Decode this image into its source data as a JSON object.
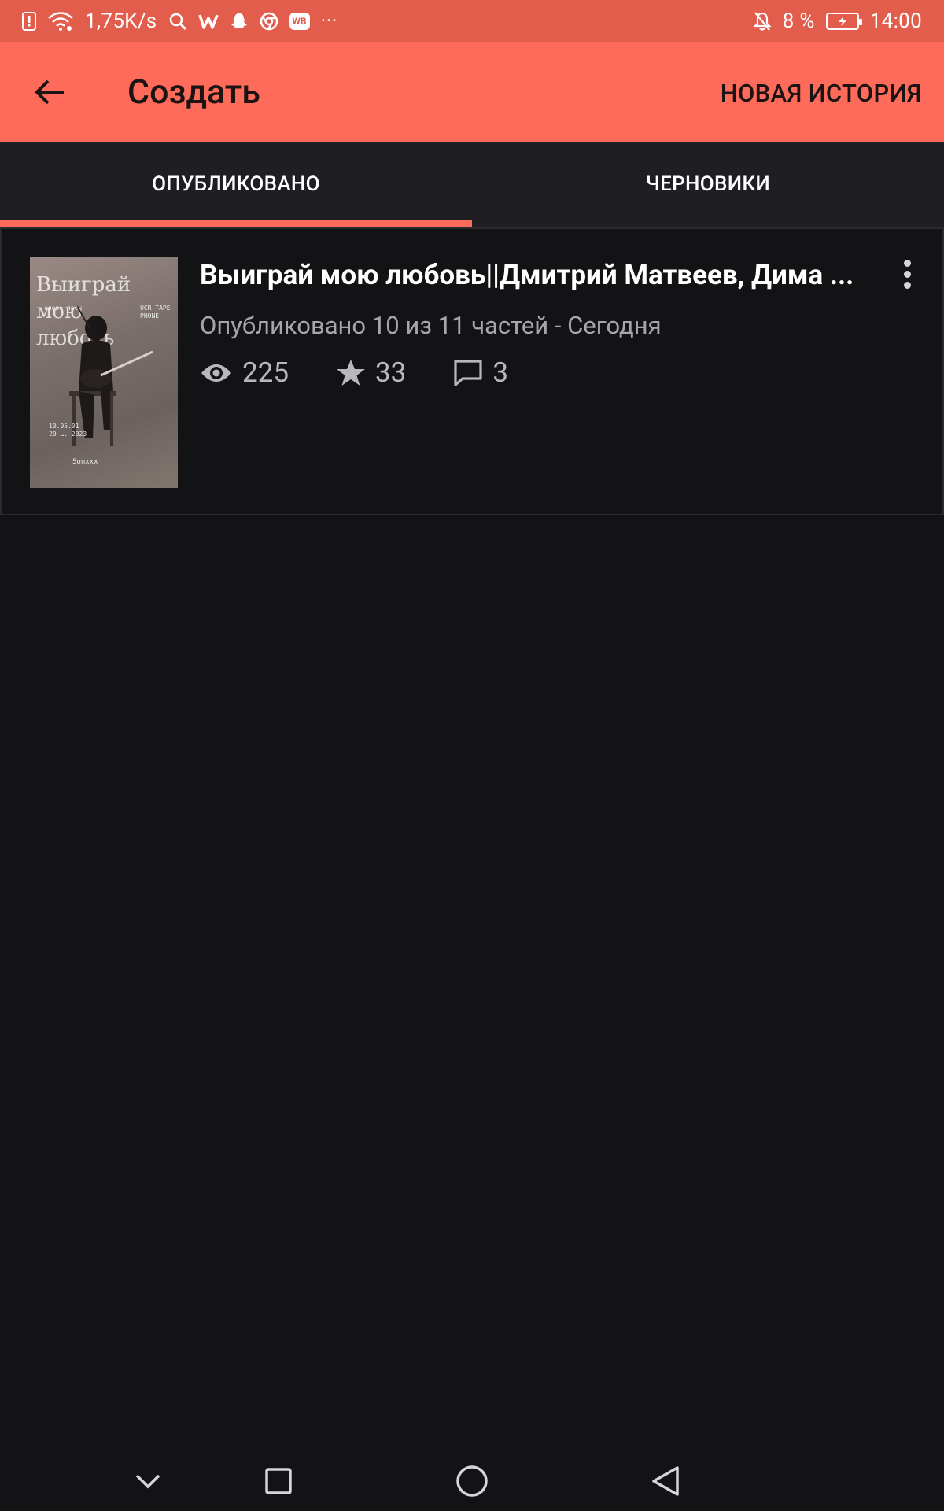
{
  "status_bar": {
    "speed": "1,75K/s",
    "battery": "8 %",
    "time": "14:00",
    "icons": [
      "alert-icon",
      "wifi-icon",
      "search-icon",
      "w-app-icon",
      "snapchat-icon",
      "chrome-icon",
      "wb-app-icon",
      "more-icon",
      "bell-off-icon",
      "battery-icon"
    ],
    "wb_label": "WB",
    "ellipsis": "···"
  },
  "app_bar": {
    "title": "Создать",
    "new_story": "НОВАЯ ИСТОРИЯ",
    "background": "#fe6b5a"
  },
  "tabs": [
    {
      "label": "ОПУБЛИКОВАНО",
      "active": true
    },
    {
      "label": "ЧЕРНОВИКИ",
      "active": false
    }
  ],
  "story": {
    "title": "Выиграй мою любовь||Дмитрий Матвеев, Дима ...",
    "meta": "Опубликовано 10 из 11 частей - Сегодня",
    "views": "225",
    "votes": "33",
    "comments": "3",
    "cover": {
      "title_lines": [
        "Выиграй",
        "мою",
        "любовь"
      ],
      "note_left": "слово пасн",
      "note_right": "UCR TAPE PHONE",
      "date": "10.05.01\n20 …. 2023",
      "handle": "Sonxxx"
    }
  },
  "colors": {
    "accent": "#fe6b5a",
    "status_bar": "#e35d4d",
    "background": "#131215"
  }
}
